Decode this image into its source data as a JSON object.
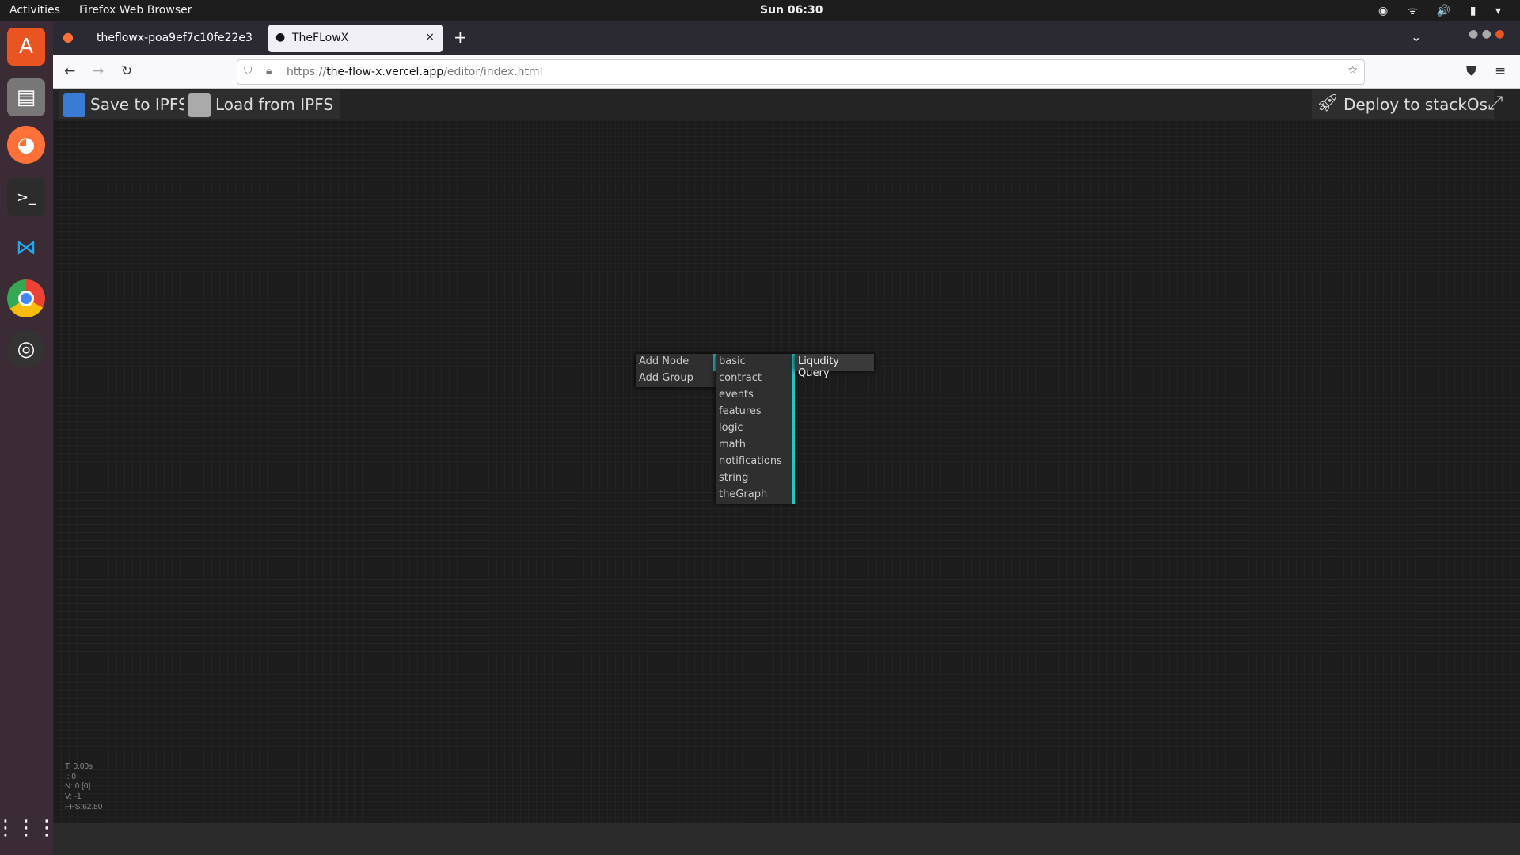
{
  "system": {
    "activities": "Activities",
    "app_name": "Firefox Web Browser",
    "clock": "Sun 06:30"
  },
  "browser": {
    "tabs": [
      {
        "label": "theflowx-poa9ef7c10fe22e3"
      },
      {
        "label": "TheFLowX"
      }
    ],
    "url_prefix": "https://",
    "url_host": "the-flow-x.vercel.app",
    "url_path": "/editor/index.html"
  },
  "toolbar": {
    "save": "Save to IPFS",
    "load": "Load from IPFS",
    "deploy": "Deploy to stackOs"
  },
  "context_menu": {
    "items": [
      "Add Node",
      "Add Group"
    ],
    "categories": [
      "basic",
      "contract",
      "events",
      "features",
      "logic",
      "math",
      "notifications",
      "string",
      "theGraph"
    ],
    "nodes": [
      "Liqudity Query"
    ]
  },
  "stats": {
    "t": "T: 0.00s",
    "i": "I: 0",
    "n": "N: 0 [0]",
    "v": "V: -1",
    "fps": "FPS:62.50"
  },
  "colors": {
    "accent": "#2bc4c4"
  }
}
